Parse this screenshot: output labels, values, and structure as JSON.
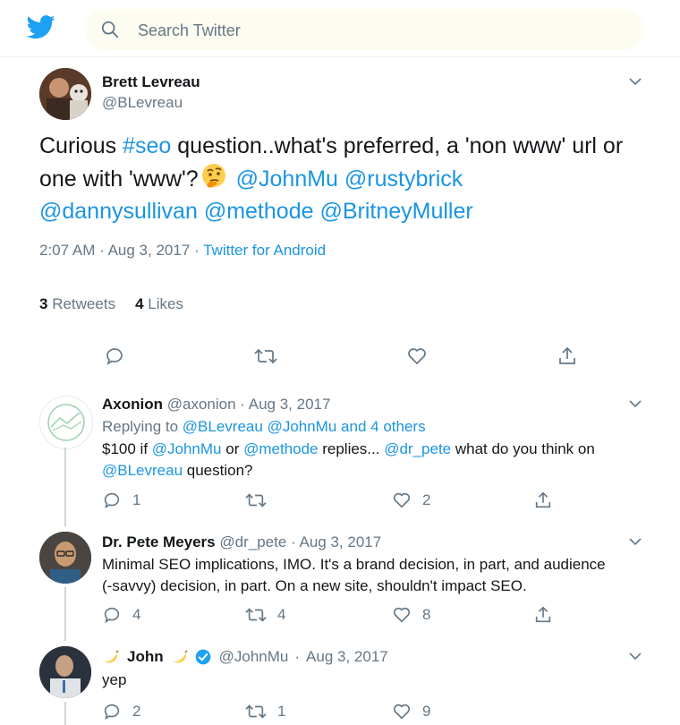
{
  "search": {
    "placeholder": "Search Twitter"
  },
  "main_tweet": {
    "name": "Brett Levreau",
    "handle": "@BLevreau",
    "text_parts": {
      "t1": "Curious ",
      "l1": "#seo",
      "t2": " question..what's preferred, a 'non www' url or one with 'www'?",
      "l2": "@JohnMu",
      "l3": "@rustybrick",
      "l4": "@dannysullivan",
      "l5": "@methode",
      "l6": "@BritneyMuller"
    },
    "time": "2:07 AM",
    "dot": "·",
    "date": "Aug 3, 2017",
    "source": "Twitter for Android",
    "retweets_count": "3",
    "retweets_label": "Retweets",
    "likes_count": "4",
    "likes_label": "Likes"
  },
  "replies": [
    {
      "name": "Axonion",
      "handle": "@axonion",
      "dot": "·",
      "date": "Aug 3, 2017",
      "replying_prefix": "Replying to",
      "replying_1": "@BLevreau",
      "replying_2": "@JohnMu",
      "replying_and": "and",
      "replying_others": "4 others",
      "text": {
        "a": "$100 if ",
        "b": "@JohnMu",
        "c": " or ",
        "d": "@methode",
        "e": " replies... ",
        "f": "@dr_pete",
        "g": " what do you think on",
        "h": "@BLevreau",
        "i": " question?"
      },
      "reply_count": "1",
      "retweet_count": "",
      "like_count": "2"
    },
    {
      "name": "Dr. Pete Meyers",
      "handle": "@dr_pete",
      "dot": "·",
      "date": "Aug 3, 2017",
      "line1": "Minimal SEO implications, IMO. It's a brand decision, in part, and audience",
      "line2": "(-savvy) decision, in part. On a new site, shouldn't impact SEO.",
      "reply_count": "4",
      "retweet_count": "4",
      "like_count": "8"
    },
    {
      "name": "John",
      "handle": "@JohnMu",
      "dot": "·",
      "date": "Aug 3, 2017",
      "text": "yep",
      "reply_count": "2",
      "retweet_count": "1",
      "like_count": "9"
    }
  ],
  "colors": {
    "brand": "#1da1f2",
    "link": "#1b95e0",
    "muted": "#657786",
    "text": "#14171a"
  },
  "icons": [
    "twitter-bird-icon",
    "search-icon",
    "chevron-down-icon",
    "reply-icon",
    "retweet-icon",
    "like-icon",
    "share-icon",
    "verified-badge-icon",
    "banana-emoji-icon",
    "thinking-face-emoji-icon"
  ]
}
